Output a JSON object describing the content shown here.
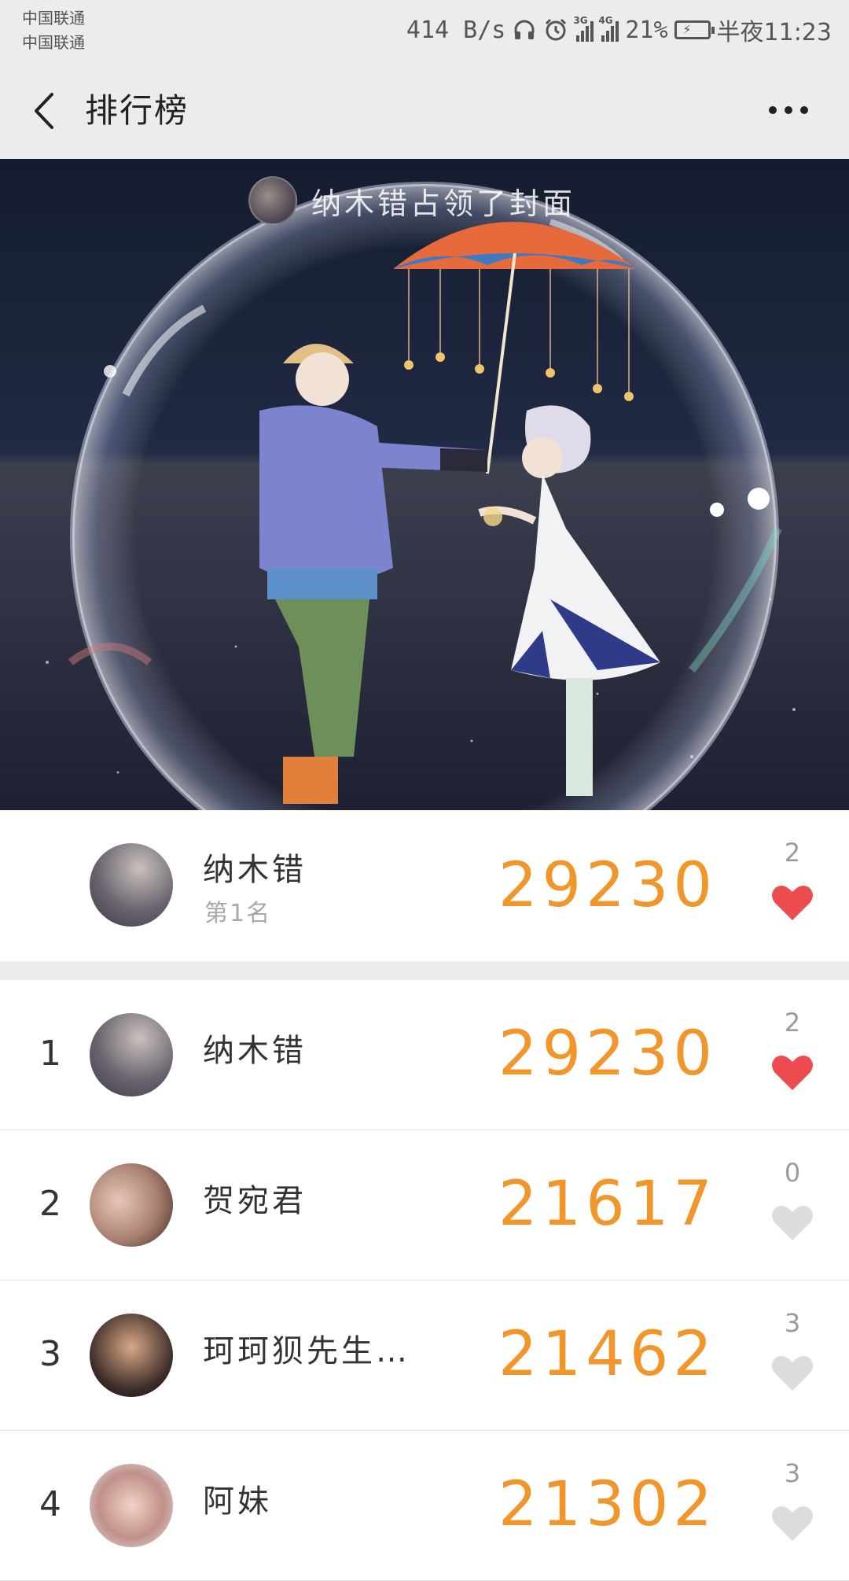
{
  "status_bar": {
    "carrier_1": "中国联通",
    "carrier_2": "中国联通",
    "net_speed": "414 B/s",
    "signal_1_type": "3G",
    "signal_2_type": "4G",
    "battery_percent": "21%",
    "time": "半夜11:23"
  },
  "app_bar": {
    "title": "排行榜"
  },
  "cover": {
    "caption": "纳木错占领了封面"
  },
  "my_rank": {
    "name": "纳木错",
    "subtitle": "第1名",
    "steps": "29230",
    "likes": "2",
    "liked": true
  },
  "ranking": [
    {
      "rank": "1",
      "name": "纳木错",
      "steps": "29230",
      "likes": "2",
      "liked": true
    },
    {
      "rank": "2",
      "name": "贺宛君",
      "steps": "21617",
      "likes": "0",
      "liked": false
    },
    {
      "rank": "3",
      "name": "珂珂狈先生…",
      "steps": "21462",
      "likes": "3",
      "liked": false
    },
    {
      "rank": "4",
      "name": "阿妹",
      "steps": "21302",
      "likes": "3",
      "liked": false
    }
  ],
  "colors": {
    "steps": "#f0962a",
    "heart_liked": "#ec4b4f",
    "heart_unliked": "#dcdcdc"
  }
}
